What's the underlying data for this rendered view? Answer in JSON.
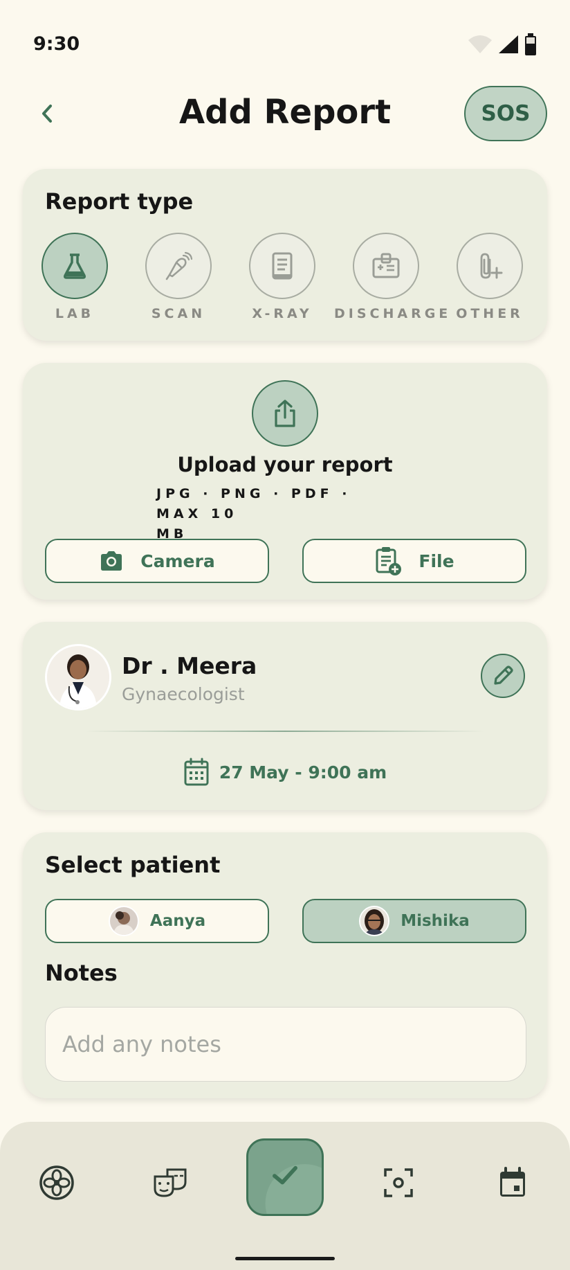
{
  "status_bar": {
    "time": "9:30"
  },
  "header": {
    "title": "Add Report",
    "sos_label": "SOS"
  },
  "report_type": {
    "title": "Report type",
    "items": [
      {
        "label": "LAB",
        "icon": "flask-icon",
        "active": true
      },
      {
        "label": "SCAN",
        "icon": "ultrasound-probe-icon",
        "active": false
      },
      {
        "label": "X-RAY",
        "icon": "document-icon",
        "active": false
      },
      {
        "label": "DISCHARGE",
        "icon": "medical-id-icon",
        "active": false
      },
      {
        "label": "OTHER",
        "icon": "attachment-add-icon",
        "active": false
      }
    ]
  },
  "upload": {
    "title": "Upload your report",
    "formats_line1": "JPG · PNG · PDF · MAX 10",
    "formats_line2": "MB",
    "camera_label": "Camera",
    "file_label": "File"
  },
  "doctor": {
    "name": "Dr . Meera",
    "specialty": "Gynaecologist",
    "appointment": "27 May - 9:00 am"
  },
  "patient": {
    "title": "Select patient",
    "options": [
      {
        "name": "Aanya",
        "selected": false
      },
      {
        "name": "Mishika",
        "selected": true
      }
    ]
  },
  "notes": {
    "title": "Notes",
    "placeholder": "Add any notes"
  },
  "bottom_nav": {
    "items": [
      "flower-icon",
      "masks-icon",
      "check-icon",
      "scan-focus-icon",
      "calendar-icon"
    ]
  },
  "colors": {
    "background": "#fcf9ee",
    "card": "#eceee0",
    "accent": "#3f7357",
    "accent_light": "#bcd1c1"
  }
}
